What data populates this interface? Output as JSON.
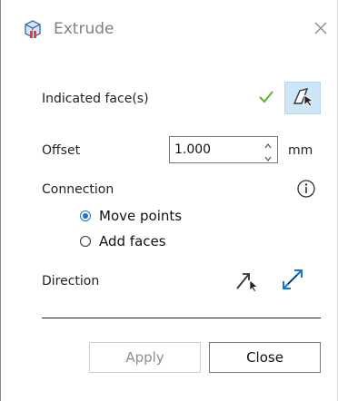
{
  "dialog": {
    "title": "Extrude"
  },
  "indicated_faces": {
    "label": "Indicated face(s)"
  },
  "offset": {
    "label": "Offset",
    "value": "1.000",
    "unit": "mm"
  },
  "connection": {
    "label": "Connection",
    "options": [
      {
        "label": "Move points",
        "selected": true
      },
      {
        "label": "Add faces",
        "selected": false
      }
    ]
  },
  "direction": {
    "label": "Direction"
  },
  "buttons": {
    "apply": "Apply",
    "close": "Close"
  },
  "colors": {
    "accent": "#1a73c9",
    "check": "#5bb12f",
    "selected_button_bg": "#cde6f7"
  },
  "icons": {
    "title": "extrude-cube-icon",
    "close": "close-icon",
    "check": "check-icon",
    "face_select": "face-select-icon",
    "info": "info-icon",
    "direction_select": "direction-select-icon",
    "direction_flip": "direction-flip-icon"
  }
}
